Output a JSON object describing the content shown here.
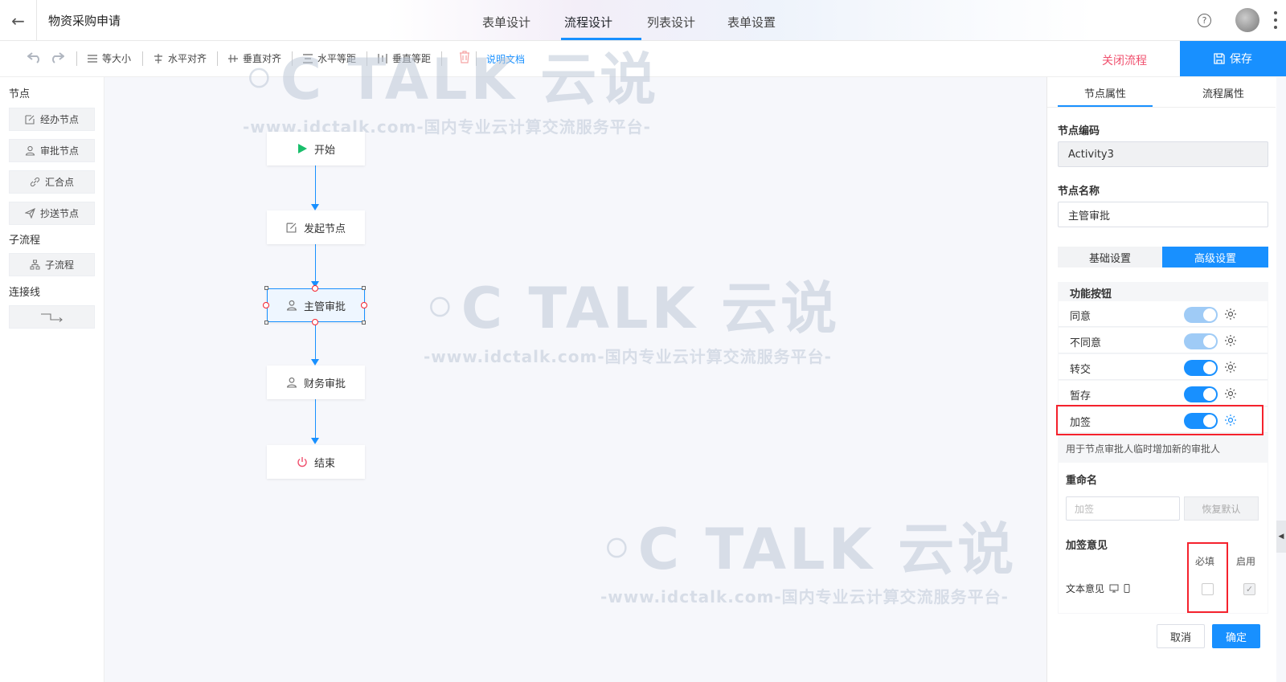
{
  "header": {
    "title": "物资采购申请",
    "tabs": [
      {
        "label": "表单设计"
      },
      {
        "label": "流程设计"
      },
      {
        "label": "列表设计"
      },
      {
        "label": "表单设置"
      }
    ],
    "active_tab": "流程设计",
    "help_glyph": "?"
  },
  "toolbar": {
    "same_size": "等大小",
    "h_align": "水平对齐",
    "v_align": "垂直对齐",
    "h_spacing": "水平等距",
    "v_spacing": "垂直等距",
    "docs": "说明文档",
    "close_flow": "关闭流程",
    "save": "保存"
  },
  "left_panel": {
    "section_nodes": "节点",
    "nodes": [
      {
        "label": "经办节点",
        "icon": "edit-icon"
      },
      {
        "label": "审批节点",
        "icon": "user-icon"
      },
      {
        "label": "汇合点",
        "icon": "link-icon"
      },
      {
        "label": "抄送节点",
        "icon": "send-icon"
      }
    ],
    "section_subflow": "子流程",
    "subflow_item": "子流程",
    "section_connector": "连接线"
  },
  "canvas": {
    "nodes": [
      {
        "label": "开始",
        "icon": "play-icon"
      },
      {
        "label": "发起节点",
        "icon": "edit-icon"
      },
      {
        "label": "主管审批",
        "icon": "user-icon"
      },
      {
        "label": "财务审批",
        "icon": "user-icon"
      },
      {
        "label": "结束",
        "icon": "power-icon"
      }
    ],
    "selected_node": "主管审批",
    "watermark_logo": "TALK 云说",
    "watermark_sub": "-www.idctalk.com-国内专业云计算交流服务平台-"
  },
  "right_panel": {
    "tabs": [
      "节点属性",
      "流程属性"
    ],
    "node_code_label": "节点编码",
    "node_code_value": "Activity3",
    "node_name_label": "节点名称",
    "node_name_value": "主管审批",
    "seg_basic": "基础设置",
    "seg_advanced": "高级设置",
    "func_title": "功能按钮",
    "functions": [
      {
        "name": "同意",
        "enabled": true
      },
      {
        "name": "不同意",
        "enabled": true
      },
      {
        "name": "转交",
        "enabled": true
      },
      {
        "name": "暂存",
        "enabled": true
      },
      {
        "name": "加签",
        "enabled": true
      }
    ],
    "func_desc": "用于节点审批人临时增加新的审批人",
    "rename_title": "重命名",
    "rename_placeholder": "加签",
    "restore_default": "恢复默认",
    "opinion_title": "加签意见",
    "col_required": "必填",
    "col_enabled": "启用",
    "text_opinion": "文本意见",
    "required_checked": false,
    "enabled_checked": true,
    "cancel": "取消",
    "ok": "确定"
  },
  "colors": {
    "accent": "#1890ff",
    "danger": "#f5222d",
    "close_flow": "#f0506e",
    "start_icon": "#19be6b",
    "end_icon": "#f0506e"
  }
}
